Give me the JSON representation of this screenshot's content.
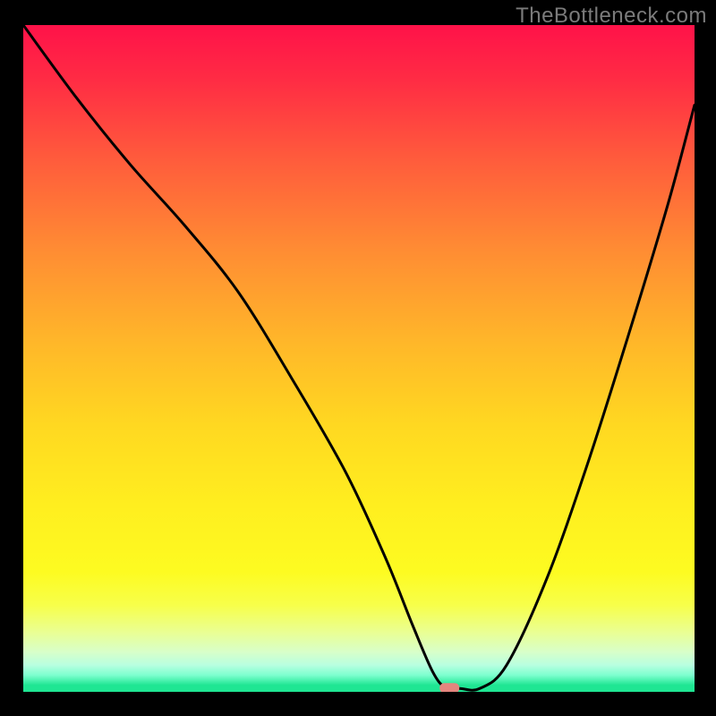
{
  "watermark": "TheBottleneck.com",
  "chart_data": {
    "type": "line",
    "title": "",
    "xlabel": "",
    "ylabel": "",
    "xlim": [
      0,
      100
    ],
    "ylim": [
      0,
      100
    ],
    "series": [
      {
        "name": "curve",
        "x": [
          0,
          8,
          16,
          24,
          32,
          40,
          48,
          54,
          58,
          61,
          63,
          65,
          68,
          72,
          78,
          84,
          90,
          96,
          100
        ],
        "values": [
          100,
          89,
          79,
          70,
          60,
          47,
          33,
          20,
          10,
          3,
          0.5,
          0.5,
          0.5,
          4,
          17,
          34,
          53,
          73,
          88
        ]
      }
    ],
    "marker": {
      "x": 63.5,
      "y": 0.5
    },
    "colors": {
      "curve": "#000000",
      "marker": "#e4857e",
      "gradient_top": "#ff1249",
      "gradient_bottom": "#1fe693"
    }
  }
}
